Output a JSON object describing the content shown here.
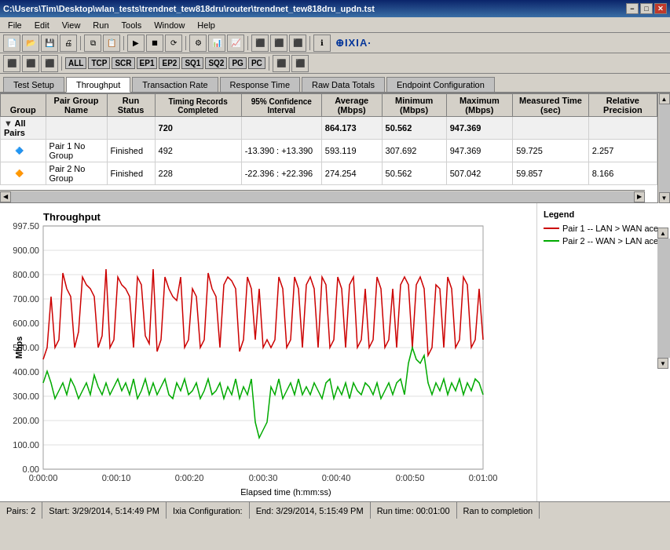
{
  "titleBar": {
    "text": "C:\\Users\\Tim\\Desktop\\wlan_tests\\trendnet_tew818dru\\router\\trendnet_tew818dru_updn.tst",
    "minBtn": "−",
    "maxBtn": "□",
    "closeBtn": "✕"
  },
  "menu": {
    "items": [
      "File",
      "Edit",
      "View",
      "Run",
      "Tools",
      "Window",
      "Help"
    ]
  },
  "toolbar": {
    "tags": [
      "ALL",
      "TCP",
      "SCR",
      "EP1",
      "EP2",
      "SQ1",
      "SQ2",
      "PG",
      "PC"
    ]
  },
  "tabs": {
    "items": [
      "Test Setup",
      "Throughput",
      "Transaction Rate",
      "Response Time",
      "Raw Data Totals",
      "Endpoint Configuration"
    ],
    "active": 1
  },
  "table": {
    "headers": {
      "group": "Group",
      "pairGroupName": "Pair Group Name",
      "runStatus": "Run Status",
      "timingRecordsCompleted": "Timing Records Completed",
      "confidence95": "95% Confidence Interval",
      "averageMbps": "Average (Mbps)",
      "minimumMbps": "Minimum (Mbps)",
      "maximumMbps": "Maximum (Mbps)",
      "measuredTimeSec": "Measured Time (sec)",
      "relativePrecision": "Relative Precision"
    },
    "allPairs": {
      "label": "All Pairs",
      "timingRecords": "720",
      "average": "864.173",
      "minimum": "50.562",
      "maximum": "947.369"
    },
    "rows": [
      {
        "icon": "▶",
        "pair": "Pair 1",
        "group": "No Group",
        "runStatus": "Finished",
        "timingRecords": "492",
        "confidence": "-13.390 : +13.390",
        "average": "593.119",
        "minimum": "307.692",
        "maximum": "947.369",
        "measuredTime": "59.725",
        "relativePrecision": "2.257"
      },
      {
        "icon": "▶",
        "pair": "Pair 2",
        "group": "No Group",
        "runStatus": "Finished",
        "timingRecords": "228",
        "confidence": "-22.396 : +22.396",
        "average": "274.254",
        "minimum": "50.562",
        "maximum": "507.042",
        "measuredTime": "59.857",
        "relativePrecision": "8.166"
      }
    ]
  },
  "chart": {
    "title": "Throughput",
    "yAxisLabel": "Mbps",
    "xAxisLabel": "Elapsed time (h:mm:ss)",
    "yTicks": [
      "997.50",
      "900.00",
      "800.00",
      "700.00",
      "600.00",
      "500.00",
      "400.00",
      "300.00",
      "200.00",
      "100.00",
      "0.00"
    ],
    "xTicks": [
      "0:00:00",
      "0:00:10",
      "0:00:20",
      "0:00:30",
      "0:00:40",
      "0:00:50",
      "0:01:00"
    ],
    "legend": {
      "title": "Legend",
      "items": [
        {
          "label": "Pair 1 -- LAN > WAN ace",
          "color": "#cc0000"
        },
        {
          "label": "Pair 2 -- WAN > LAN ace",
          "color": "#00aa00"
        }
      ]
    }
  },
  "statusBar": {
    "pairs": "Pairs: 2",
    "start": "Start: 3/29/2014, 5:14:49 PM",
    "ixia": "Ixia Configuration:",
    "end": "End: 3/29/2014, 5:15:49 PM",
    "runTime": "Run time: 00:01:00",
    "completion": "Ran to completion"
  }
}
